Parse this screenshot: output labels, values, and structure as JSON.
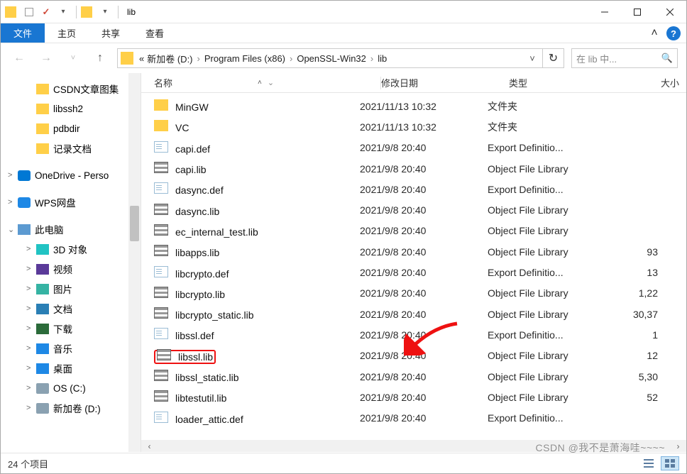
{
  "window": {
    "title": "lib"
  },
  "ribbon": {
    "tabs": [
      "文件",
      "主页",
      "共享",
      "查看"
    ]
  },
  "address": {
    "crumbs": [
      "«",
      "新加卷 (D:)",
      "Program Files (x86)",
      "OpenSSL-Win32",
      "lib"
    ],
    "search_placeholder": "在 lib 中..."
  },
  "tree": {
    "items": [
      {
        "icon": "folder",
        "label": "CSDN文章图集",
        "indent": 1
      },
      {
        "icon": "folder",
        "label": "libssh2",
        "indent": 1
      },
      {
        "icon": "folder",
        "label": "pdbdir",
        "indent": 1
      },
      {
        "icon": "folder",
        "label": "记录文档",
        "indent": 1
      },
      {
        "spacer": true
      },
      {
        "icon": "onedrive",
        "label": "OneDrive - Perso",
        "indent": 0,
        "chev": ">"
      },
      {
        "spacer": true
      },
      {
        "icon": "wps",
        "label": "WPS网盘",
        "indent": 0,
        "chev": ">"
      },
      {
        "spacer": true
      },
      {
        "icon": "pc",
        "label": "此电脑",
        "indent": 0,
        "chev": "⌄"
      },
      {
        "icon": "obj3d",
        "label": "3D 对象",
        "indent": 1,
        "chev": ">"
      },
      {
        "icon": "video",
        "label": "视频",
        "indent": 1,
        "chev": ">"
      },
      {
        "icon": "pic",
        "label": "图片",
        "indent": 1,
        "chev": ">"
      },
      {
        "icon": "doc",
        "label": "文档",
        "indent": 1,
        "chev": ">"
      },
      {
        "icon": "down",
        "label": "下载",
        "indent": 1,
        "chev": ">"
      },
      {
        "icon": "music",
        "label": "音乐",
        "indent": 1,
        "chev": ">"
      },
      {
        "icon": "desk",
        "label": "桌面",
        "indent": 1,
        "chev": ">"
      },
      {
        "icon": "drive",
        "label": "OS (C:)",
        "indent": 1,
        "chev": ">"
      },
      {
        "icon": "drive",
        "label": "新加卷 (D:)",
        "indent": 1,
        "chev": ">"
      }
    ]
  },
  "columns": {
    "name": "名称",
    "date": "修改日期",
    "type": "类型",
    "size": "大小"
  },
  "rows": [
    {
      "icon": "folder",
      "name": "MinGW",
      "date": "2021/11/13 10:32",
      "type": "文件夹",
      "size": ""
    },
    {
      "icon": "folder",
      "name": "VC",
      "date": "2021/11/13 10:32",
      "type": "文件夹",
      "size": ""
    },
    {
      "icon": "def",
      "name": "capi.def",
      "date": "2021/9/8 20:40",
      "type": "Export Definitio...",
      "size": ""
    },
    {
      "icon": "lib",
      "name": "capi.lib",
      "date": "2021/9/8 20:40",
      "type": "Object File Library",
      "size": ""
    },
    {
      "icon": "def",
      "name": "dasync.def",
      "date": "2021/9/8 20:40",
      "type": "Export Definitio...",
      "size": ""
    },
    {
      "icon": "lib",
      "name": "dasync.lib",
      "date": "2021/9/8 20:40",
      "type": "Object File Library",
      "size": ""
    },
    {
      "icon": "lib",
      "name": "ec_internal_test.lib",
      "date": "2021/9/8 20:40",
      "type": "Object File Library",
      "size": ""
    },
    {
      "icon": "lib",
      "name": "libapps.lib",
      "date": "2021/9/8 20:40",
      "type": "Object File Library",
      "size": "93"
    },
    {
      "icon": "def",
      "name": "libcrypto.def",
      "date": "2021/9/8 20:40",
      "type": "Export Definitio...",
      "size": "13"
    },
    {
      "icon": "lib",
      "name": "libcrypto.lib",
      "date": "2021/9/8 20:40",
      "type": "Object File Library",
      "size": "1,22"
    },
    {
      "icon": "lib",
      "name": "libcrypto_static.lib",
      "date": "2021/9/8 20:40",
      "type": "Object File Library",
      "size": "30,37"
    },
    {
      "icon": "def",
      "name": "libssl.def",
      "date": "2021/9/8 20:40",
      "type": "Export Definitio...",
      "size": "1"
    },
    {
      "icon": "lib",
      "name": "libssl.lib",
      "date": "2021/9/8 20:40",
      "type": "Object File Library",
      "size": "12",
      "highlight": true
    },
    {
      "icon": "lib",
      "name": "libssl_static.lib",
      "date": "2021/9/8 20:40",
      "type": "Object File Library",
      "size": "5,30"
    },
    {
      "icon": "lib",
      "name": "libtestutil.lib",
      "date": "2021/9/8 20:40",
      "type": "Object File Library",
      "size": "52"
    },
    {
      "icon": "def",
      "name": "loader_attic.def",
      "date": "2021/9/8 20:40",
      "type": "Export Definitio...",
      "size": ""
    }
  ],
  "status": {
    "count": "24 个项目"
  },
  "watermark": "CSDN @我不是萧海哇~~~~"
}
